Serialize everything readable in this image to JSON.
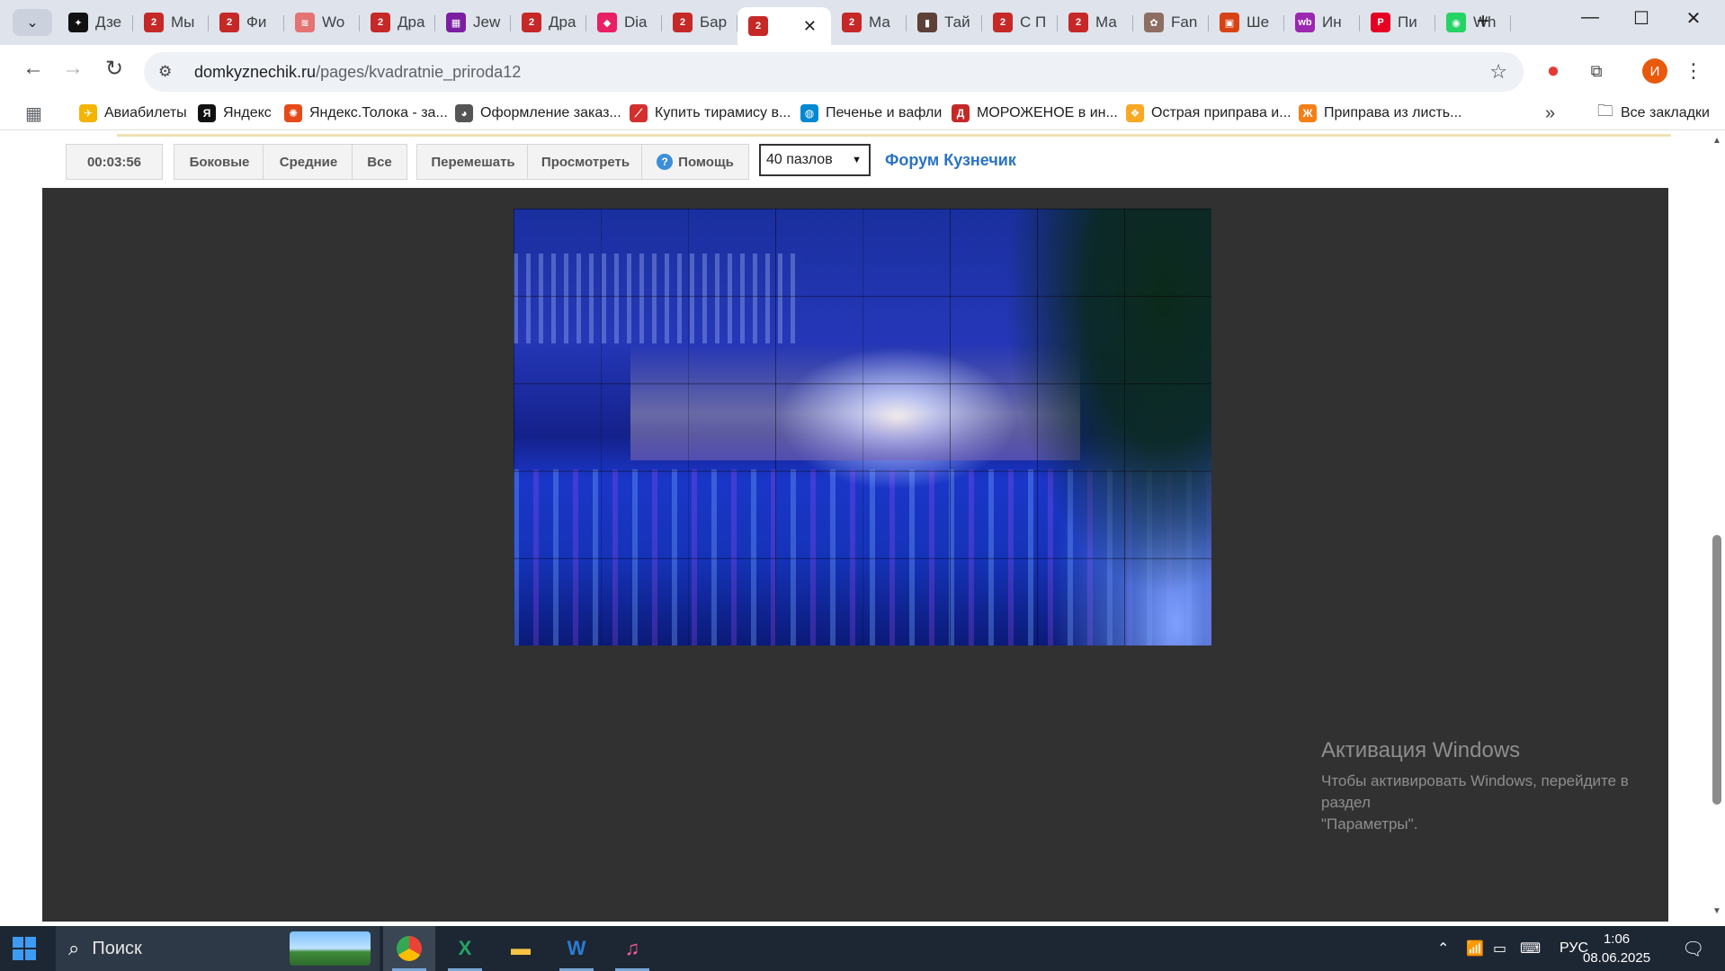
{
  "tabs": [
    {
      "label": "Дзе",
      "color": "#111111",
      "glyph": "✦"
    },
    {
      "label": "Мы",
      "color": "#c62828",
      "glyph": "2"
    },
    {
      "label": "Фи",
      "color": "#c62828",
      "glyph": "2"
    },
    {
      "label": "Wo",
      "color": "#e57373",
      "glyph": "≋"
    },
    {
      "label": "Дра",
      "color": "#c62828",
      "glyph": "2"
    },
    {
      "label": "Jew",
      "color": "#7b1fa2",
      "glyph": "▦"
    },
    {
      "label": "Дра",
      "color": "#c62828",
      "glyph": "2"
    },
    {
      "label": "Dia",
      "color": "#e91e63",
      "glyph": "◆"
    },
    {
      "label": "Бар",
      "color": "#c62828",
      "glyph": "2"
    },
    {
      "label": "",
      "color": "#c62828",
      "glyph": "2",
      "active": true
    },
    {
      "label": "Ма",
      "color": "#c62828",
      "glyph": "2"
    },
    {
      "label": "Тай",
      "color": "#5d4037",
      "glyph": "▮"
    },
    {
      "label": "С П",
      "color": "#c62828",
      "glyph": "2"
    },
    {
      "label": "Ма",
      "color": "#c62828",
      "glyph": "2"
    },
    {
      "label": "Fan",
      "color": "#8d6e63",
      "glyph": "✿"
    },
    {
      "label": "Ше",
      "color": "#d84315",
      "glyph": "▣"
    },
    {
      "label": "Ин",
      "color": "#9c27b0",
      "glyph": "wb"
    },
    {
      "label": "Пи",
      "color": "#e60023",
      "glyph": "P"
    },
    {
      "label": "Wh",
      "color": "#25d366",
      "glyph": "◉"
    }
  ],
  "address": {
    "domain": "domkyznechik.ru",
    "path": "/pages/kvadratnie_priroda12"
  },
  "bookmarks": [
    {
      "label": "Авиабилеты",
      "color": "#f4b400",
      "glyph": "✈"
    },
    {
      "label": "Яндекс",
      "color": "#111111",
      "glyph": "Я"
    },
    {
      "label": "Яндекс.Толока - за...",
      "color": "#e64a19",
      "glyph": "✺"
    },
    {
      "label": "Оформление заказ...",
      "color": "#555555",
      "glyph": "◕"
    },
    {
      "label": "Купить тирамису в...",
      "color": "#d32f2f",
      "glyph": "⟋"
    },
    {
      "label": "Печенье и вафли",
      "color": "#0288d1",
      "glyph": "◍"
    },
    {
      "label": "МОРОЖЕНОЕ в ин...",
      "color": "#c62828",
      "glyph": "Д"
    },
    {
      "label": "Острая приправа и...",
      "color": "#f9a825",
      "glyph": "❖"
    },
    {
      "label": "Приправа из листь...",
      "color": "#f57f17",
      "glyph": "Ж"
    }
  ],
  "all_bookmarks_label": "Все закладки",
  "game": {
    "timer": "00:03:56",
    "btn_sides": "Боковые",
    "btn_middle": "Средние",
    "btn_all": "Все",
    "btn_shuffle": "Перемешать",
    "btn_preview": "Просмотреть",
    "btn_help": "Помощь",
    "pieces_select": "40 пазлов",
    "forum_link": "Форум Кузнечик",
    "grid_cols": 8,
    "grid_rows": 5
  },
  "watermark": {
    "title": "Активация Windows",
    "line1": "Чтобы активировать Windows, перейдите в раздел",
    "line2": "\"Параметры\"."
  },
  "taskbar": {
    "search_placeholder": "Поиск",
    "lang": "РУС",
    "time": "1:06",
    "date": "08.06.2025"
  },
  "avatar_letter": "И"
}
